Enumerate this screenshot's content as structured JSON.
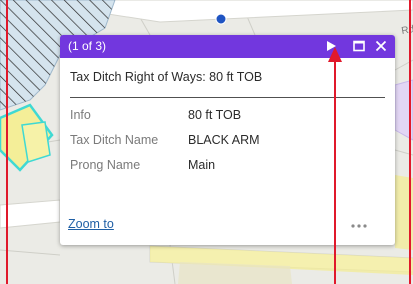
{
  "map": {
    "road_label": "Rd"
  },
  "popup": {
    "counter": "(1 of 3)",
    "title": "Tax Ditch Right of Ways: 80 ft TOB",
    "fields": [
      {
        "key": "Info",
        "value": "80 ft TOB"
      },
      {
        "key": "Tax Ditch Name",
        "value": "BLACK ARM"
      },
      {
        "key": "Prong Name",
        "value": "Main"
      }
    ],
    "zoom_label": "Zoom to",
    "header_color": "#7237de",
    "icons": {
      "next": "play-next-icon",
      "maximize": "maximize-icon",
      "close": "close-icon",
      "more": "ellipsis-icon"
    }
  },
  "annotation": {
    "color": "#e0192b"
  }
}
